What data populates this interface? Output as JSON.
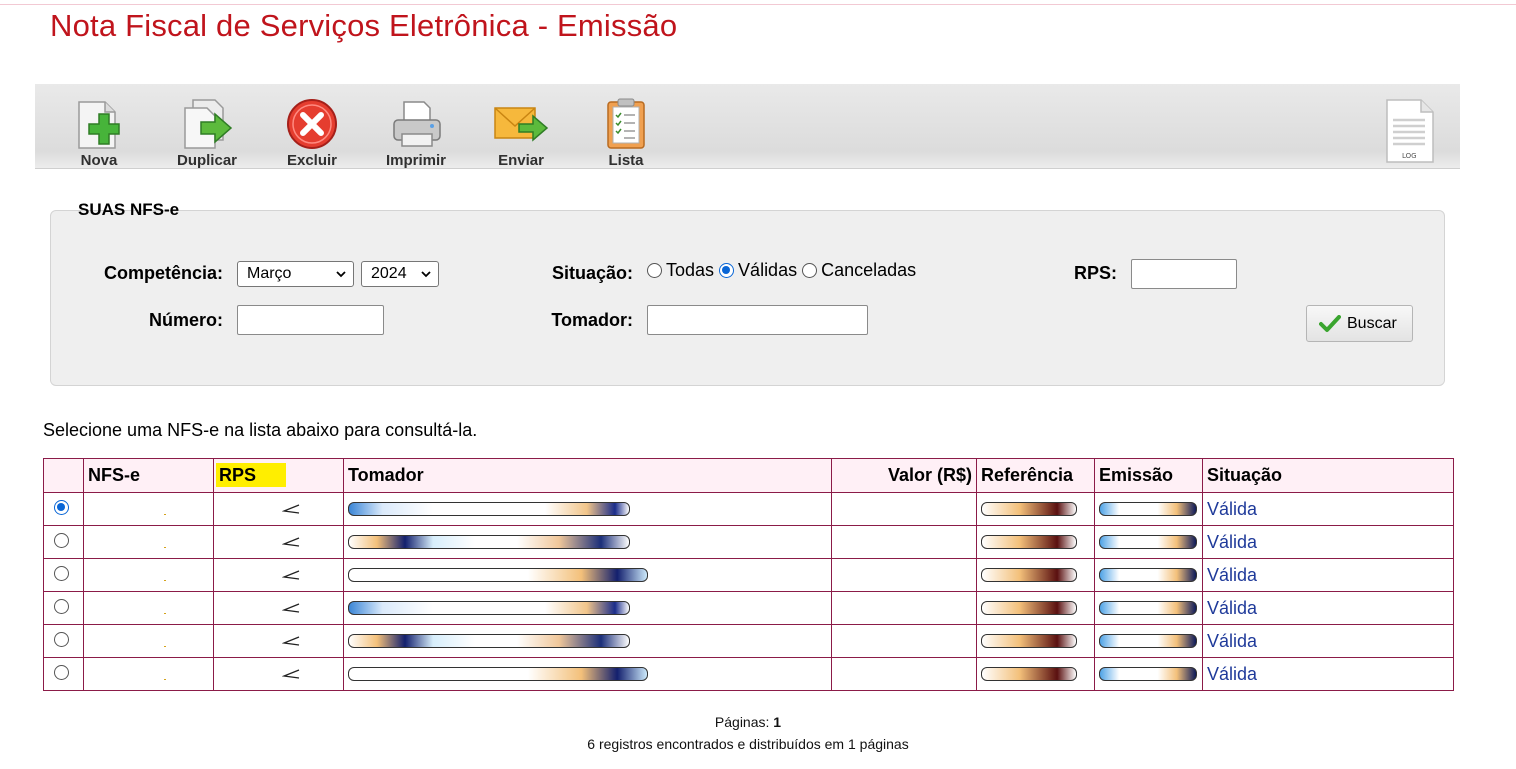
{
  "page": {
    "title": "Nota Fiscal de Serviços Eletrônica - Emissão"
  },
  "toolbar": {
    "buttons": [
      {
        "label": "Nova",
        "icon": "new-document-plus-icon"
      },
      {
        "label": "Duplicar",
        "icon": "duplicate-document-icon"
      },
      {
        "label": "Excluir",
        "icon": "delete-x-icon"
      },
      {
        "label": "Imprimir",
        "icon": "printer-icon"
      },
      {
        "label": "Enviar",
        "icon": "send-envelope-icon"
      },
      {
        "label": "Lista",
        "icon": "clipboard-list-icon"
      }
    ],
    "log_icon": "log-file-icon"
  },
  "filters": {
    "legend": "SUAS NFS-e",
    "competencia_label": "Competência:",
    "month": "Março",
    "year": "2024",
    "situacao_label": "Situação:",
    "situacao_options": [
      "Todas",
      "Válidas",
      "Canceladas"
    ],
    "situacao_selected": "Válidas",
    "rps_label": "RPS:",
    "numero_label": "Número:",
    "tomador_label": "Tomador:",
    "search_button": "Buscar"
  },
  "hint": "Selecione uma NFS-e na lista abaixo para consultá-la.",
  "table": {
    "headers": [
      "NFS-e",
      "RPS",
      "Tomador",
      "Valor (R$)",
      "Referência",
      "Emissão",
      "Situação"
    ],
    "rows": [
      {
        "selected": true,
        "situacao": "Válida"
      },
      {
        "selected": false,
        "situacao": "Válida"
      },
      {
        "selected": false,
        "situacao": "Válida"
      },
      {
        "selected": false,
        "situacao": "Válida"
      },
      {
        "selected": false,
        "situacao": "Válida"
      },
      {
        "selected": false,
        "situacao": "Válida"
      }
    ]
  },
  "pager": {
    "pages_label": "Páginas:",
    "current_page": "1",
    "summary": "6 registros encontrados e distribuídos em 1 páginas"
  },
  "colors": {
    "title": "#c0141c",
    "table_border": "#8b1b48",
    "header_bg": "#fff0f6",
    "link": "#1f3a9a",
    "rps_highlight": "#ffee00"
  }
}
